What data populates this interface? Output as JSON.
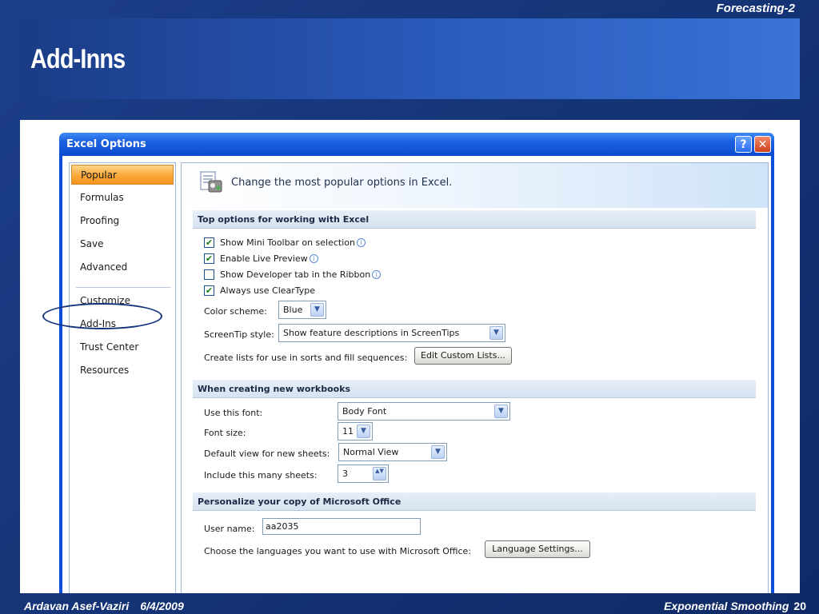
{
  "slide": {
    "top_label": "Forecasting-2",
    "title": "Add-Inns",
    "footer_author": "Ardavan Asef-Vaziri",
    "footer_date": "6/4/2009",
    "footer_title": "Exponential Smoothing",
    "page_number": "20"
  },
  "dialog": {
    "title": "Excel Options",
    "help_glyph": "?",
    "close_glyph": "✕"
  },
  "nav": {
    "items": [
      {
        "label": "Popular",
        "selected": true
      },
      {
        "label": "Formulas"
      },
      {
        "label": "Proofing"
      },
      {
        "label": "Save"
      },
      {
        "label": "Advanced"
      },
      {
        "label": "Customize"
      },
      {
        "label": "Add-Ins"
      },
      {
        "label": "Trust Center"
      },
      {
        "label": "Resources"
      }
    ]
  },
  "main": {
    "banner_text": "Change the most popular options in Excel.",
    "sections": {
      "top": {
        "heading": "Top options for working with Excel",
        "checkbox_mini_toolbar": "Show Mini Toolbar on selection",
        "checkbox_live_preview": "Enable Live Preview",
        "checkbox_developer_tab": "Show Developer tab in the Ribbon",
        "checkbox_cleartype": "Always use ClearType",
        "color_scheme_label": "Color scheme:",
        "color_scheme_value": "Blue",
        "screentip_label": "ScreenTip style:",
        "screentip_value": "Show feature descriptions in ScreenTips",
        "lists_label": "Create lists for use in sorts and fill sequences:",
        "edit_lists_button": "Edit Custom Lists..."
      },
      "workbooks": {
        "heading": "When creating new workbooks",
        "font_label": "Use this font:",
        "font_value": "Body Font",
        "size_label": "Font size:",
        "size_value": "11",
        "view_label": "Default view for new sheets:",
        "view_value": "Normal View",
        "sheets_label": "Include this many sheets:",
        "sheets_value": "3"
      },
      "personalize": {
        "heading": "Personalize your copy of Microsoft Office",
        "username_label": "User name:",
        "username_value": "aa2035",
        "languages_label": "Choose the languages you want to use with Microsoft Office:",
        "language_button": "Language Settings..."
      }
    },
    "checked_mark": "✔",
    "info_glyph": "i",
    "dropdown_glyph": "▼",
    "spin_glyph": "▲▼"
  },
  "colors": {
    "slide_background": "#16367a",
    "title_band": "#2a5bbd",
    "dialog_titlebar": "#0a4ad0",
    "nav_selected": "#f9a83a",
    "annotation_circle": "#13357c"
  }
}
